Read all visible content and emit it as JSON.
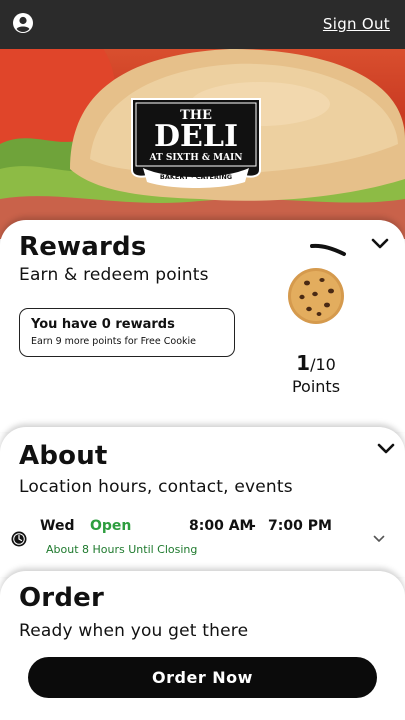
{
  "header": {
    "signout_label": "Sign Out"
  },
  "hero": {
    "logo_the": "THE",
    "logo_deli": "DELI",
    "logo_location": "AT SIXTH & MAIN",
    "logo_tagline": "BAKERY · CATERING"
  },
  "rewards": {
    "title": "Rewards",
    "subtitle": "Earn & redeem points",
    "box_title": "You have 0 rewards",
    "box_sub": "Earn 9 more points for Free Cookie",
    "points_current": "1",
    "points_total": "/10",
    "points_label": "Points",
    "progress": 0.1
  },
  "about": {
    "title": "About",
    "subtitle": "Location hours, contact, events",
    "day": "Wed",
    "status": "Open",
    "open_time": "8:00 AM",
    "dash": "-",
    "close_time": "7:00 PM",
    "until_closing": "About 8 Hours Until Closing"
  },
  "order": {
    "title": "Order",
    "subtitle": "Ready when you get there",
    "button_label": "Order Now"
  },
  "colors": {
    "topbar": "#2b2b2b",
    "open_green": "#2e9e3f",
    "button": "#0b0b0b"
  },
  "icons": [
    "account-icon",
    "chevron-down-icon",
    "cookie-icon",
    "clock-icon"
  ]
}
